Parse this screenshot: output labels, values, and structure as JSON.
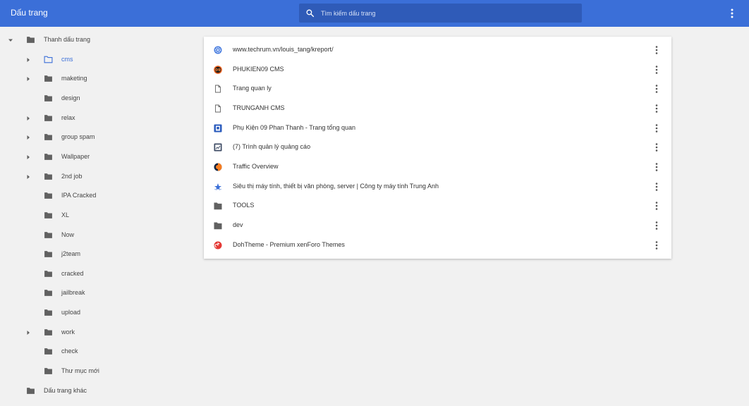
{
  "app": {
    "title": "Dấu trang"
  },
  "search": {
    "placeholder": "Tìm kiếm dấu trang"
  },
  "colors": {
    "topbar": "#3b6fd8",
    "search_bg": "#2f5bb8",
    "selected_text": "#3b6fd8",
    "folder": "#616161",
    "page_bg": "#f1f1f1"
  },
  "tree": {
    "root": {
      "label": "Thanh dấu trang",
      "icon": "folder-icon",
      "expanded": true
    },
    "items": [
      {
        "label": "cms",
        "has_children": true,
        "selected": true,
        "icon": "folder-outline-icon"
      },
      {
        "label": "maketing",
        "has_children": true,
        "icon": "folder-icon"
      },
      {
        "label": "design",
        "has_children": false,
        "icon": "folder-icon"
      },
      {
        "label": "relax",
        "has_children": true,
        "icon": "folder-icon"
      },
      {
        "label": "group spam",
        "has_children": true,
        "icon": "folder-icon"
      },
      {
        "label": "Wallpaper",
        "has_children": true,
        "icon": "folder-icon"
      },
      {
        "label": "2nd job",
        "has_children": true,
        "icon": "folder-icon"
      },
      {
        "label": "IPA Cracked",
        "has_children": false,
        "icon": "folder-icon"
      },
      {
        "label": "XL",
        "has_children": false,
        "icon": "folder-icon"
      },
      {
        "label": "Now",
        "has_children": false,
        "icon": "folder-icon"
      },
      {
        "label": "j2team",
        "has_children": false,
        "icon": "folder-icon"
      },
      {
        "label": "cracked",
        "has_children": false,
        "icon": "folder-icon"
      },
      {
        "label": "jailbreak",
        "has_children": false,
        "icon": "folder-icon"
      },
      {
        "label": "upload",
        "has_children": false,
        "icon": "folder-icon"
      },
      {
        "label": "work",
        "has_children": true,
        "icon": "folder-icon"
      },
      {
        "label": "check",
        "has_children": false,
        "icon": "folder-icon"
      },
      {
        "label": "Thư mục mới",
        "has_children": false,
        "icon": "folder-icon"
      }
    ],
    "other": {
      "label": "Dấu trang khác",
      "icon": "folder-icon"
    }
  },
  "bookmarks": [
    {
      "label": "www.techrum.vn/louis_tang/kreport/",
      "icon": "gear-favicon-icon"
    },
    {
      "label": "PHUKIEN09 CMS",
      "icon": "phukien09-favicon-icon"
    },
    {
      "label": "Trang quan ly",
      "icon": "page-icon"
    },
    {
      "label": "TRUNGANH CMS",
      "icon": "page-icon"
    },
    {
      "label": "Phụ Kiện 09 Phan Thanh - Trang tổng quan",
      "icon": "wordpress-favicon-icon"
    },
    {
      "label": "(7) Trình quản lý quảng cáo",
      "icon": "ads-manager-favicon-icon"
    },
    {
      "label": "Traffic Overview",
      "icon": "similarweb-favicon-icon"
    },
    {
      "label": "Siêu thị máy tính, thiết bị văn phòng, server | Công ty máy tính Trung Anh",
      "icon": "trunganh-favicon-icon"
    },
    {
      "label": "TOOLS",
      "icon": "folder-icon"
    },
    {
      "label": "dev",
      "icon": "folder-icon"
    },
    {
      "label": "DohTheme - Premium xenForo Themes",
      "icon": "dohtheme-favicon-icon"
    }
  ]
}
